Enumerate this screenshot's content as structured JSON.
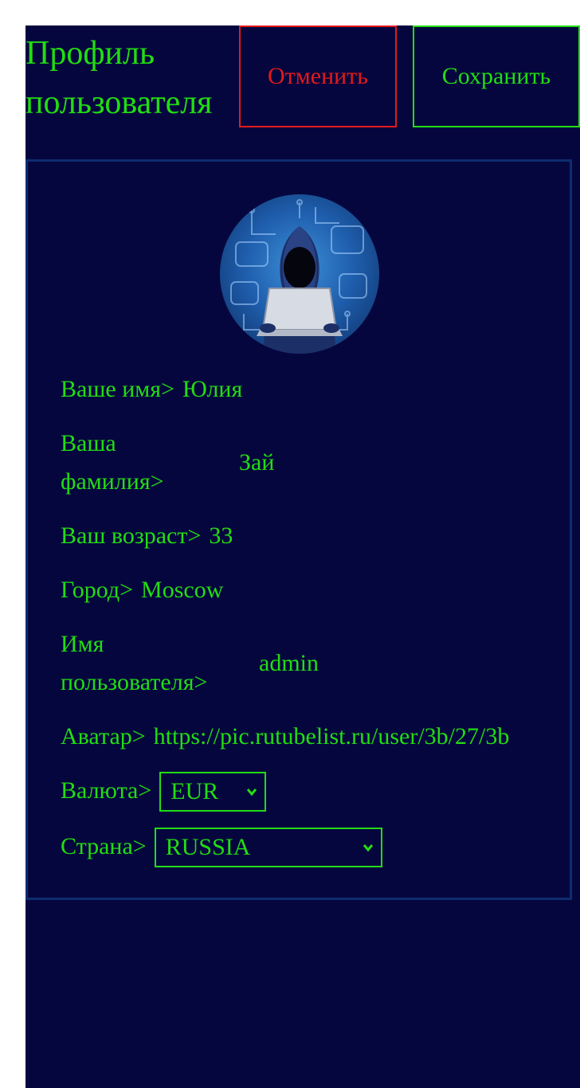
{
  "header": {
    "title": "Профиль пользователя",
    "cancel_label": "Отменить",
    "save_label": "Сохранить"
  },
  "profile": {
    "first_name": {
      "label": "Ваше имя>",
      "value": "Юлия"
    },
    "last_name": {
      "label": "Ваша фамилия>",
      "value": "Зай"
    },
    "age": {
      "label": "Ваш возраст>",
      "value": "33"
    },
    "city": {
      "label": "Город>",
      "value": "Moscow"
    },
    "username": {
      "label": "Имя пользователя>",
      "value": "admin"
    },
    "avatar_url": {
      "label": "Аватар>",
      "value": "https://pic.rutubelist.ru/user/3b/27/3b"
    },
    "currency": {
      "label": "Валюта>",
      "selected": "EUR"
    },
    "country": {
      "label": "Страна>",
      "selected": "RUSSIA"
    }
  },
  "colors": {
    "background": "#06063f",
    "text": "#22dd11",
    "cancel": "#e31a1a",
    "card_border": "#0e2c6f"
  },
  "icons": {
    "avatar": "hooded-hacker-avatar",
    "select_arrow": "chevron-down-icon"
  }
}
